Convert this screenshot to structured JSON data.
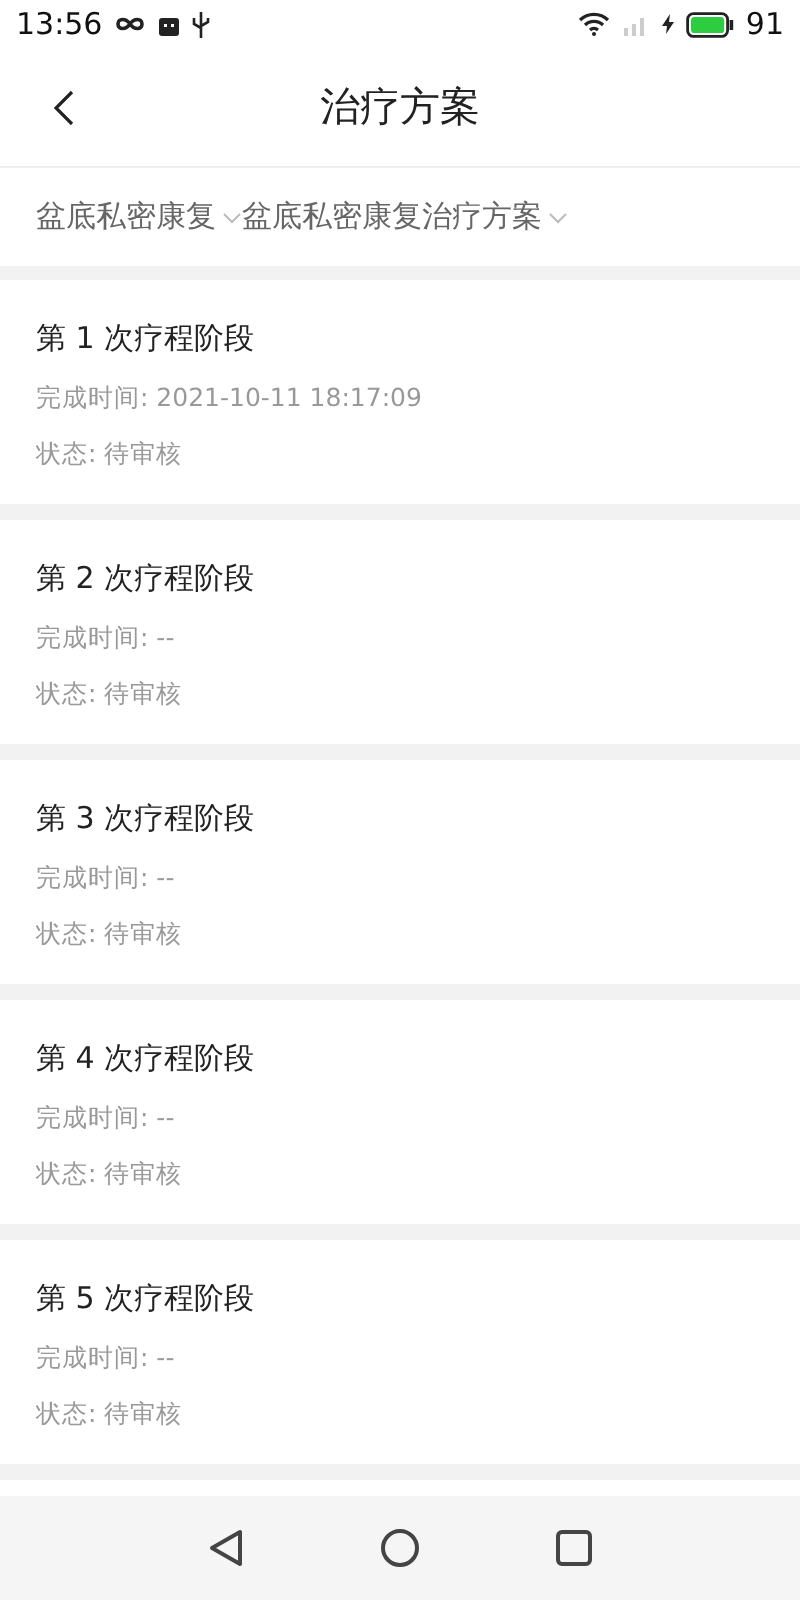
{
  "status_bar": {
    "time": "13:56",
    "battery": "91"
  },
  "header": {
    "title": "治疗方案"
  },
  "filters": [
    {
      "label": "盆底私密康复"
    },
    {
      "label": "盆底私密康复治疗方案"
    }
  ],
  "stages": [
    {
      "title": "第 1 次疗程阶段",
      "completed": "完成时间: 2021-10-11 18:17:09",
      "status": "状态: 待审核"
    },
    {
      "title": "第 2 次疗程阶段",
      "completed": "完成时间: --",
      "status": "状态: 待审核"
    },
    {
      "title": "第 3 次疗程阶段",
      "completed": "完成时间: --",
      "status": "状态: 待审核"
    },
    {
      "title": "第 4 次疗程阶段",
      "completed": "完成时间: --",
      "status": "状态: 待审核"
    },
    {
      "title": "第 5 次疗程阶段",
      "completed": "完成时间: --",
      "status": "状态: 待审核"
    }
  ]
}
